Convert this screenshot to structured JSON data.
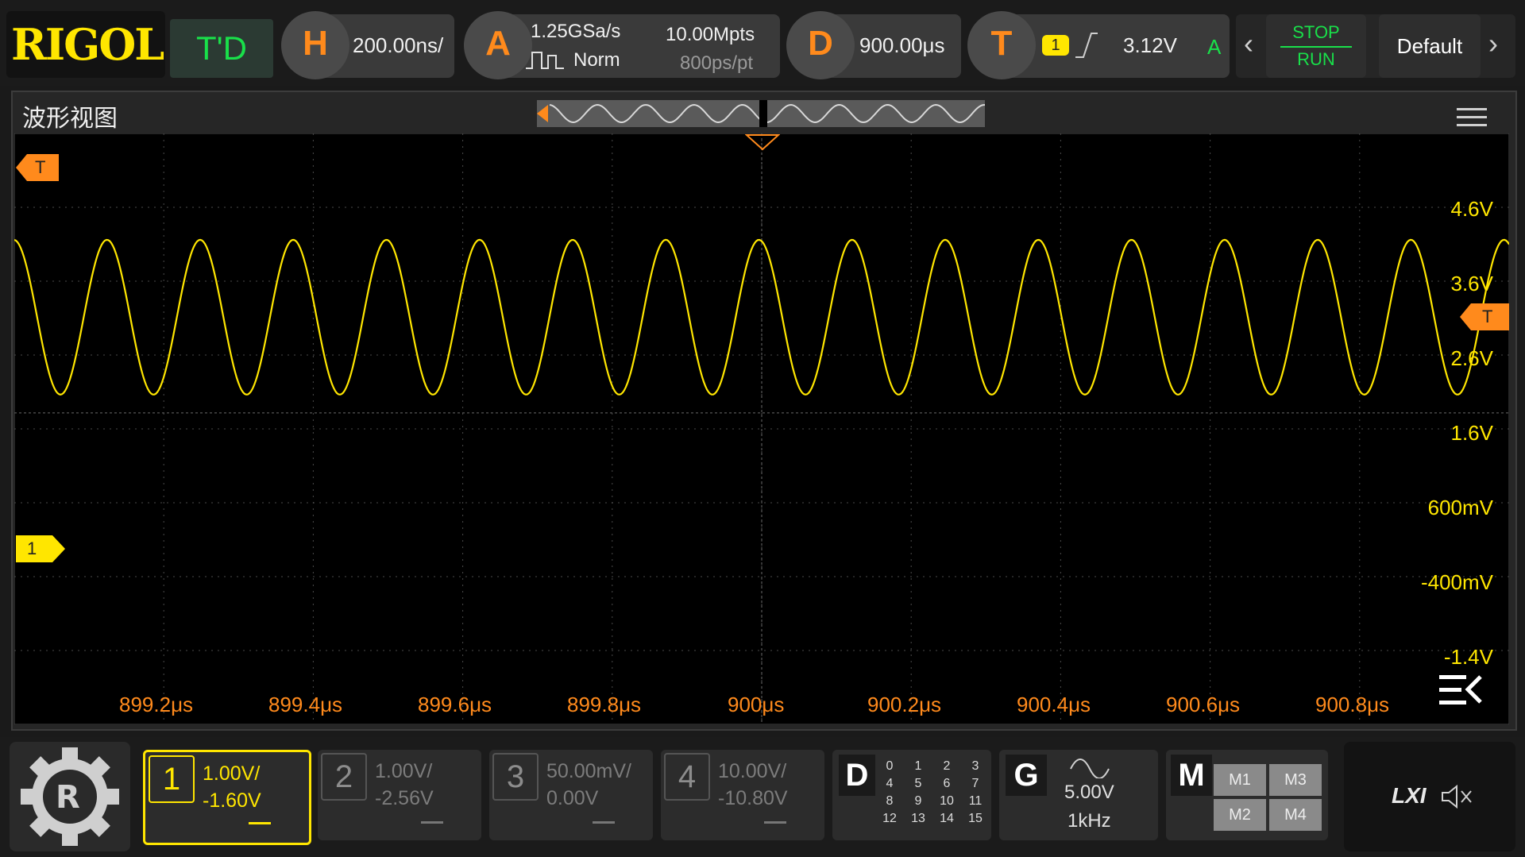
{
  "brand": "RIGOL",
  "mode": "T'D",
  "horizontal": {
    "key": "H",
    "scale": "200.00ns/"
  },
  "acquire": {
    "key": "A",
    "sample_rate": "1.25GSa/s",
    "mode": "Norm",
    "memory": "10.00Mpts",
    "resolution": "800ps/pt"
  },
  "delay": {
    "key": "D",
    "value": "900.00μs"
  },
  "trigger": {
    "key": "T",
    "source": "1",
    "level": "3.12V",
    "sweep": "A"
  },
  "run": {
    "stop": "STOP",
    "run": "RUN"
  },
  "default_label": "Default",
  "view": {
    "title": "波形视图"
  },
  "markers": {
    "trigger": "T",
    "trigger_level": "T",
    "channel1": "1"
  },
  "time_labels": [
    "899.2μs",
    "899.4μs",
    "899.6μs",
    "899.8μs",
    "900μs",
    "900.2μs",
    "900.4μs",
    "900.6μs",
    "900.8μs"
  ],
  "volt_labels": [
    "4.6V",
    "3.6V",
    "2.6V",
    "1.6V",
    "600mV",
    "-400mV",
    "-1.4V"
  ],
  "channels": [
    {
      "num": "1",
      "scale": "1.00V/",
      "offset": "-1.60V",
      "active": true
    },
    {
      "num": "2",
      "scale": "1.00V/",
      "offset": "-2.56V",
      "active": false
    },
    {
      "num": "3",
      "scale": "50.00mV/",
      "offset": "0.00V",
      "active": false
    },
    {
      "num": "4",
      "scale": "10.00V/",
      "offset": "-10.80V",
      "active": false
    }
  ],
  "digital": {
    "key": "D",
    "bits": [
      "0",
      "1",
      "2",
      "3",
      "4",
      "5",
      "6",
      "7",
      "8",
      "9",
      "10",
      "11",
      "12",
      "13",
      "14",
      "15"
    ]
  },
  "generator": {
    "key": "G",
    "amplitude": "5.00V",
    "frequency": "1kHz"
  },
  "math": {
    "key": "M",
    "items": [
      "M1",
      "M3",
      "M2",
      "M4"
    ]
  },
  "lxi": "LXI",
  "colors": {
    "ch1": "#ffe600",
    "accent": "#ff8a1c",
    "run": "#19e04a"
  }
}
